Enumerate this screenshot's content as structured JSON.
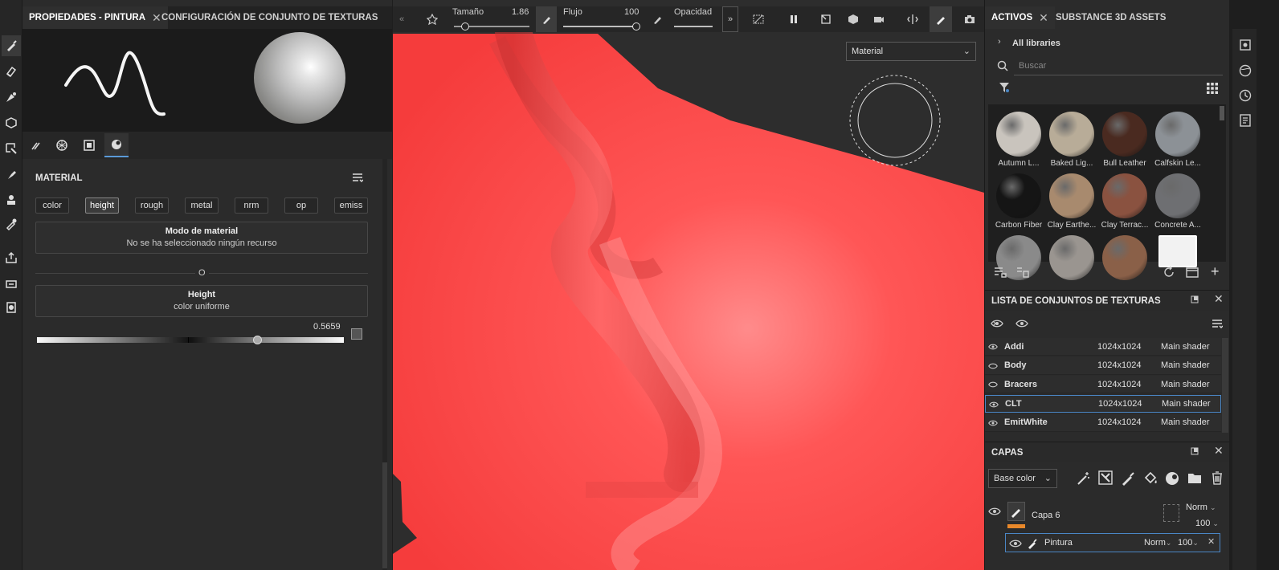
{
  "left_rail": {
    "tools": [
      "brush-icon",
      "eraser-icon",
      "projection-icon",
      "polygon-fill-icon",
      "geometry-mask-icon",
      "smudge-icon",
      "clone-icon",
      "color-picker-icon",
      "export-icon",
      "bake-icon",
      "render-icon"
    ]
  },
  "properties": {
    "tabs": [
      {
        "label": "PROPIEDADES - PINTURA",
        "close": "✕"
      },
      {
        "label": "CONFIGURACIÓN DE CONJUNTO DE TEXTURAS"
      }
    ],
    "section_title": "MATERIAL",
    "channels": [
      "color",
      "height",
      "rough",
      "metal",
      "nrm",
      "op",
      "emiss"
    ],
    "selected_channel": "height",
    "material_mode": {
      "title": "Modo de material",
      "subtitle": "No se ha seleccionado ningún recurso"
    },
    "separator_label": "O",
    "height_box": {
      "title": "Height",
      "subtitle": "color uniforme"
    },
    "height_value": "0.5659",
    "height_fraction": 0.72
  },
  "viewport_toolbar": {
    "size_label": "Tamaño",
    "size_value": "1.86",
    "flow_label": "Flujo",
    "flow_value": "100",
    "opacity_label": "Opacidad",
    "expand": "»",
    "collapse": "«"
  },
  "viewport": {
    "material_dropdown": "Material",
    "surface_color": "#ff4747"
  },
  "assets": {
    "tabs": [
      {
        "label": "ACTIVOS",
        "close": "✕"
      },
      {
        "label": "SUBSTANCE 3D ASSETS"
      }
    ],
    "libraries_label": "All libraries",
    "search_placeholder": "Buscar",
    "items": [
      {
        "name": "Autumn L...",
        "color": "#c9c4bd"
      },
      {
        "name": "Baked Lig...",
        "color": "#b8ac98"
      },
      {
        "name": "Bull Leather",
        "color": "#4a2a20"
      },
      {
        "name": "Calfskin Le...",
        "color": "#8c9196"
      },
      {
        "name": "Carbon Fiber",
        "color": "#151515"
      },
      {
        "name": "Clay Earthe...",
        "color": "#a88a6e"
      },
      {
        "name": "Clay Terrac...",
        "color": "#8a5240"
      },
      {
        "name": "Concrete A...",
        "color": "#6e6f72"
      },
      {
        "name": "",
        "color": "#8a8a8a"
      },
      {
        "name": "",
        "color": "#9a9590"
      },
      {
        "name": "",
        "color": "#8a6048"
      },
      {
        "name": "",
        "color": "#f2f2f2"
      }
    ]
  },
  "texture_sets": {
    "title": "LISTA DE CONJUNTOS DE TEXTURAS",
    "rows": [
      {
        "name": "Addi",
        "res": "1024x1024",
        "shader": "Main shader"
      },
      {
        "name": "Body",
        "res": "1024x1024",
        "shader": "Main shader"
      },
      {
        "name": "Bracers",
        "res": "1024x1024",
        "shader": "Main shader"
      },
      {
        "name": "CLT",
        "res": "1024x1024",
        "shader": "Main shader"
      },
      {
        "name": "EmitWhite",
        "res": "1024x1024",
        "shader": "Main shader"
      }
    ],
    "selected": "CLT"
  },
  "layers": {
    "title": "CAPAS",
    "channel_dropdown": "Base color",
    "layer": {
      "name": "Capa 6",
      "blend": "Norm",
      "opacity": "100"
    },
    "effect": {
      "name": "Pintura",
      "blend": "Norm",
      "opacity": "100"
    }
  },
  "colors": {
    "accent_blue": "#4a86c5",
    "layer_orange": "#e8882a"
  }
}
